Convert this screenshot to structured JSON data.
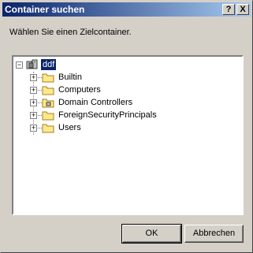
{
  "window": {
    "title": "Container suchen",
    "help_label": "?",
    "close_label": "X"
  },
  "prompt": "Wählen Sie einen Zielcontainer.",
  "tree": {
    "root": {
      "label": "ddf",
      "expander": "−",
      "icon": "domain-icon",
      "selected": true
    },
    "children": [
      {
        "label": "Builtin",
        "expander": "+",
        "icon": "folder-icon"
      },
      {
        "label": "Computers",
        "expander": "+",
        "icon": "folder-icon"
      },
      {
        "label": "Domain Controllers",
        "expander": "+",
        "icon": "ou-folder-icon"
      },
      {
        "label": "ForeignSecurityPrincipals",
        "expander": "+",
        "icon": "folder-icon"
      },
      {
        "label": "Users",
        "expander": "+",
        "icon": "folder-icon"
      }
    ]
  },
  "buttons": {
    "ok": "OK",
    "cancel": "Abbrechen"
  }
}
